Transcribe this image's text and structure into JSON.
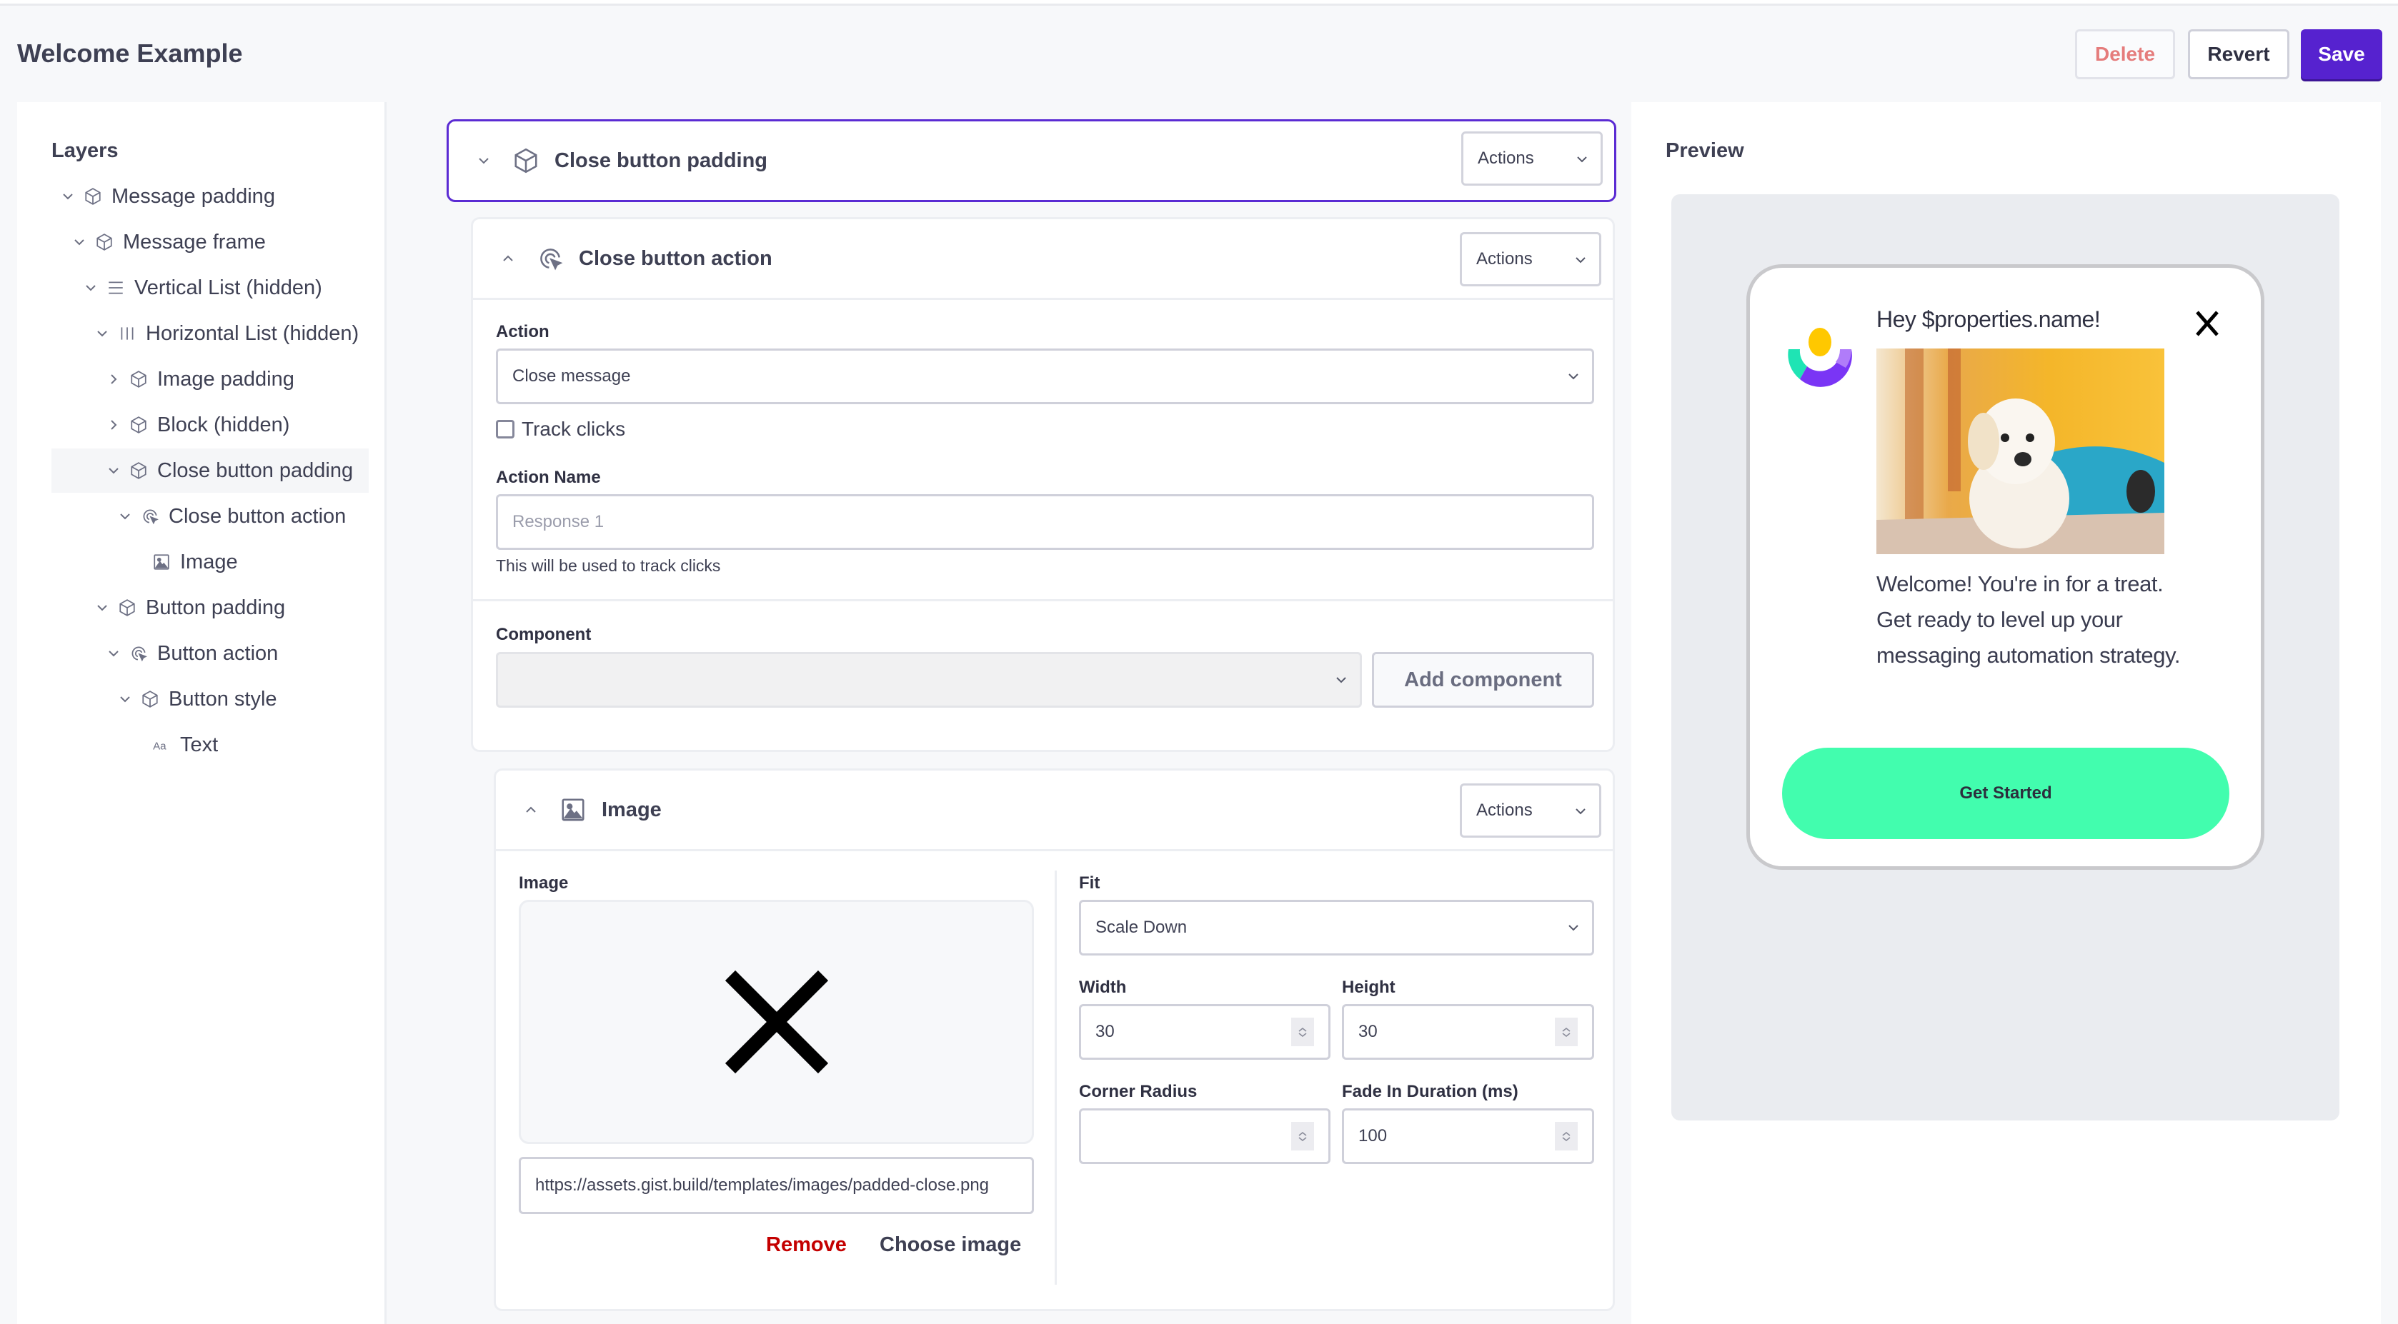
{
  "header": {
    "title": "Welcome Example",
    "delete_label": "Delete",
    "revert_label": "Revert",
    "save_label": "Save"
  },
  "layers": {
    "title": "Layers",
    "items": [
      {
        "label": "Message padding",
        "icon": "cube-icon",
        "expanded": true
      },
      {
        "label": "Message frame",
        "icon": "cube-icon",
        "expanded": true
      },
      {
        "label": "Vertical List (hidden)",
        "icon": "vertical-list-icon",
        "expanded": true
      },
      {
        "label": "Horizontal List (hidden)",
        "icon": "horizontal-list-icon",
        "expanded": true
      },
      {
        "label": "Image padding",
        "icon": "cube-icon",
        "expanded": false
      },
      {
        "label": "Block (hidden)",
        "icon": "cube-icon",
        "expanded": false
      },
      {
        "label": "Close button padding",
        "icon": "cube-icon",
        "expanded": true,
        "selected": true
      },
      {
        "label": "Close button action",
        "icon": "click-target-icon",
        "expanded": true
      },
      {
        "label": "Image",
        "icon": "image-icon"
      },
      {
        "label": "Button padding",
        "icon": "cube-icon",
        "expanded": true
      },
      {
        "label": "Button action",
        "icon": "click-target-icon",
        "expanded": true
      },
      {
        "label": "Button style",
        "icon": "cube-icon",
        "expanded": true
      },
      {
        "label": "Text",
        "icon": "text-icon"
      }
    ]
  },
  "editor": {
    "close_button_padding": {
      "title": "Close button padding",
      "actions_label": "Actions"
    },
    "close_button_action": {
      "title": "Close button action",
      "actions_label": "Actions",
      "action_label": "Action",
      "action_value": "Close message",
      "track_clicks_label": "Track clicks",
      "track_clicks_checked": false,
      "action_name_label": "Action Name",
      "action_name_placeholder": "Response 1",
      "action_name_help": "This will be used to track clicks",
      "component_label": "Component",
      "component_value": "",
      "add_component_label": "Add component"
    },
    "image": {
      "title": "Image",
      "actions_label": "Actions",
      "image_label": "Image",
      "image_url": "https://assets.gist.build/templates/images/padded-close.png",
      "remove_label": "Remove",
      "choose_label": "Choose image",
      "fit_label": "Fit",
      "fit_value": "Scale Down",
      "width_label": "Width",
      "width_value": "30",
      "height_label": "Height",
      "height_value": "30",
      "corner_radius_label": "Corner Radius",
      "corner_radius_value": "",
      "fade_label": "Fade In Duration (ms)",
      "fade_value": "100"
    }
  },
  "preview": {
    "title": "Preview",
    "message": {
      "heading": "Hey $properties.name!",
      "body": "Welcome! You're in for a treat. Get ready to level up your messaging automation strategy.",
      "cta_label": "Get Started"
    }
  },
  "colors": {
    "accent": "#5622cf",
    "danger": "#c40000",
    "delete_text": "#e57c7c",
    "cta": "#42fdae"
  }
}
